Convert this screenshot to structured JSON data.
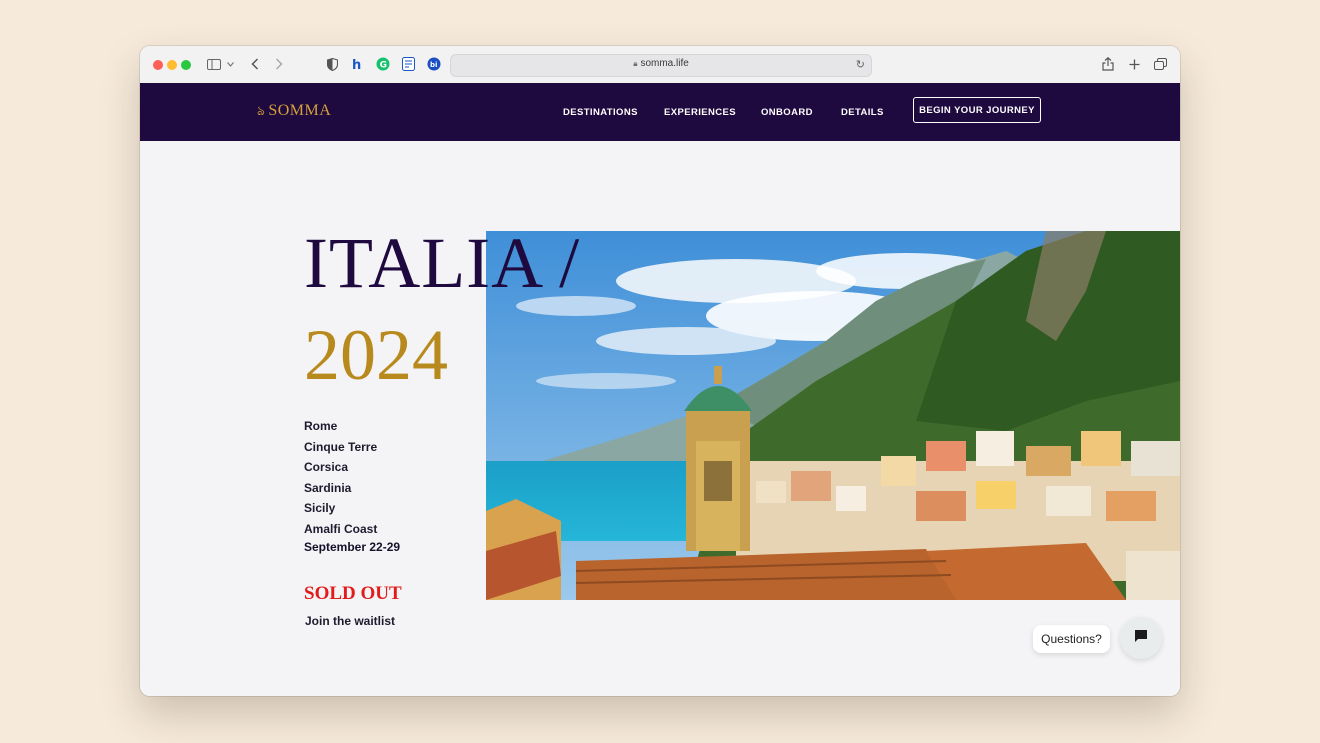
{
  "browser": {
    "url": "somma.life",
    "traffic_lights": [
      "#ff5f57",
      "#febc2e",
      "#28c840"
    ],
    "toolbar_icons": [
      "sidebar-icon",
      "chevron-down-icon",
      "back-icon",
      "forward-icon",
      "shield-icon",
      "extension-h-icon",
      "grammarly-icon",
      "notes-extension-icon",
      "bitwarden-icon",
      "share-icon",
      "new-tab-icon",
      "tabs-overview-icon"
    ]
  },
  "nav": {
    "logo": "SOMMA",
    "links": [
      "DESTINATIONS",
      "EXPERIENCES",
      "ONBOARD",
      "DETAILS"
    ],
    "cta": "BEGIN YOUR JOURNEY",
    "bg_color": "#1f0a3f",
    "logo_color": "#d4a13a"
  },
  "hero": {
    "title": "ITALIA /",
    "year": "2024",
    "destinations": [
      "Rome",
      "Cinque Terre",
      "Corsica",
      "Sardinia",
      "Sicily",
      "Amalfi Coast"
    ],
    "dates": "September 22-29",
    "status": "SOLD OUT",
    "waitlist": "Join the waitlist",
    "accent_gold": "#b88a1d",
    "sold_color": "#e21b1b"
  },
  "chat": {
    "prompt": "Questions?"
  }
}
